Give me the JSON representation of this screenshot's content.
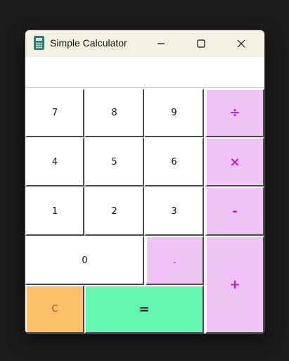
{
  "window": {
    "title": "Simple Calculator"
  },
  "display": {
    "value": ""
  },
  "buttons": {
    "seven": "7",
    "eight": "8",
    "nine": "9",
    "divide": "÷",
    "four": "4",
    "five": "5",
    "six": "6",
    "multiply": "×",
    "one": "1",
    "two": "2",
    "three": "3",
    "subtract": "-",
    "zero": "0",
    "decimal": ".",
    "add": "+",
    "clear": "C",
    "equals": "="
  },
  "colors": {
    "operator_bg": "#efc3f6",
    "operator_text": "#d012d8",
    "clear_bg": "#fcc06a",
    "clear_text": "#e32a14",
    "equals_bg": "#65f7b1",
    "titlebar_bg": "#f4f1e2"
  },
  "icons": {
    "app": "calculator-icon",
    "minimize": "minimize-icon",
    "maximize": "maximize-icon",
    "close": "close-icon"
  }
}
